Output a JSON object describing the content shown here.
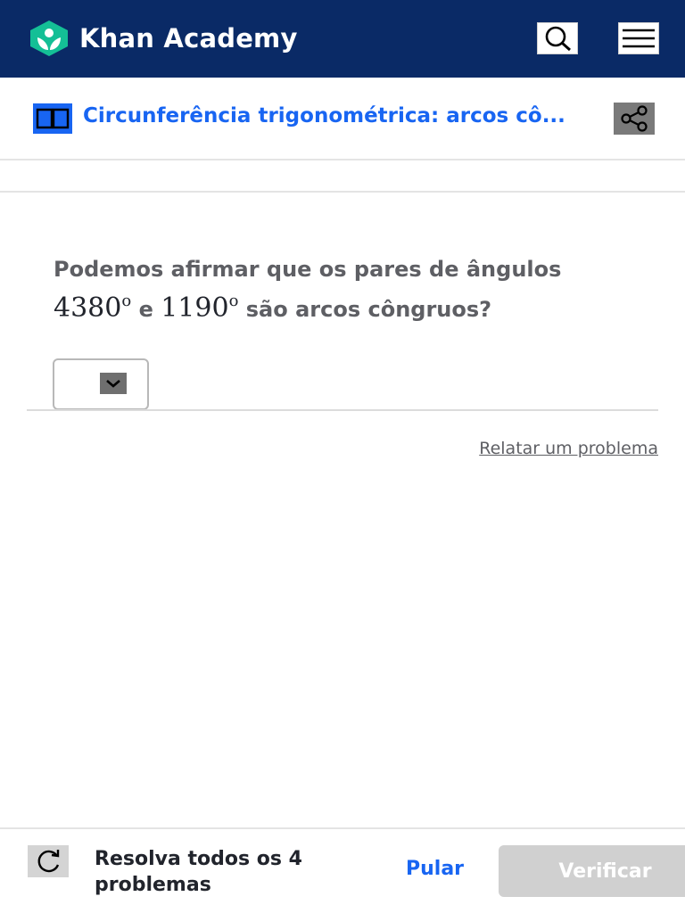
{
  "header": {
    "brand": "Khan Academy",
    "search_icon": "search-icon",
    "menu_icon": "hamburger-menu-icon",
    "background_color": "#0a2a66",
    "logo_color": "#14bf96"
  },
  "exercise": {
    "title": "Circunferência trigonométrica: arcos cô...",
    "title_icon": "book-icon",
    "share_icon": "share-icon",
    "accent_color": "#1865f2"
  },
  "question": {
    "text_before": "Podemos afirmar que os pares de ângulos",
    "angle1": "4380",
    "angle1_unit": "o",
    "conjunction": "e",
    "angle2": "1190",
    "angle2_unit": "o",
    "text_after": "são arcos côngruos?",
    "answer_dropdown": {
      "selected": "",
      "icon": "chevron-down-icon"
    }
  },
  "report_link": "Relatar um problema",
  "footer": {
    "refresh_icon": "refresh-icon",
    "progress_text": "Resolva todos os 4 problemas",
    "skip_label": "Pular",
    "check_label": "Verificar"
  }
}
